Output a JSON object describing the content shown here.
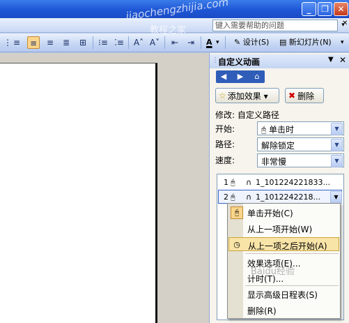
{
  "window": {
    "buttons": [
      "_",
      "❐",
      "✕"
    ]
  },
  "menubar": {
    "help_placeholder": "键入需要帮助的问题",
    "help_dropdown": "▾",
    "close_doc": "✕"
  },
  "toolbar": {
    "design_label": "设计(S)",
    "new_slide_label": "新幻灯片(N)",
    "font_color_letter": "A"
  },
  "task_pane": {
    "title": "自定义动画",
    "add_effect": "添加效果 ▾",
    "remove": "删除",
    "modify_label": "修改: 自定义路径",
    "start_label": "开始:",
    "start_value": "单击时",
    "path_label": "路径:",
    "path_value": "解除锁定",
    "speed_label": "速度:",
    "speed_value": "非常慢",
    "items": [
      {
        "index": "1",
        "name": "1_101224221833..."
      },
      {
        "index": "2",
        "name": "1_1012242218..."
      }
    ]
  },
  "context_menu": {
    "items": [
      {
        "label": "单击开始(C)"
      },
      {
        "label": "从上一项开始(W)"
      },
      {
        "label": "从上一项之后开始(A)"
      },
      {
        "label": "效果选项(E)..."
      },
      {
        "label": "计时(T)..."
      },
      {
        "label": "显示高级日程表(S)"
      },
      {
        "label": "删除(R)"
      }
    ]
  },
  "watermark": {
    "site": "jiaochengzhijia.com",
    "name": "教程之家",
    "corner": "Baidu经验"
  },
  "colors": {
    "titlebar": "#1f56d6",
    "highlight": "#f9e4a8",
    "pane_bg": "#f6f4ec"
  }
}
